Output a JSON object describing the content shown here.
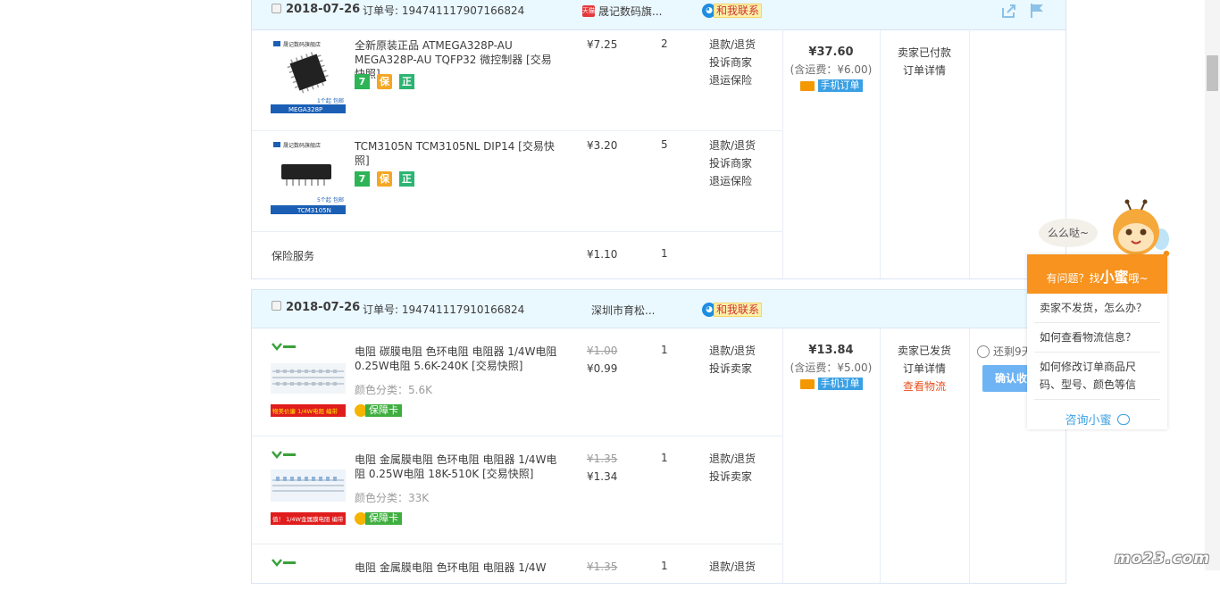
{
  "orders": [
    {
      "date": "2018-07-26",
      "order_no": "订单号: 194741117907166824",
      "shop_name": "晟记数码旗...",
      "contact": "和我联系",
      "items": [
        {
          "title": "全新原装正品 ATMEGA328P-AU MEGA328P-AU TQFP32 微控制器 [交易快照]",
          "price": "¥7.25",
          "qty": "2",
          "after_sale": [
            "退款/退货",
            "投诉商家",
            "退运保险"
          ],
          "badges": [
            "7",
            "保",
            "正"
          ],
          "thumb_caption": "MEGA328P",
          "thumb_store": "晟记数码旗舰店",
          "thumb_tag": "1个起",
          "thumb_free": "包邮"
        },
        {
          "title": "TCM3105N TCM3105NL DIP14 [交易快照]",
          "price": "¥3.20",
          "qty": "5",
          "after_sale": [
            "退款/退货",
            "投诉商家",
            "退运保险"
          ],
          "badges": [
            "7",
            "保",
            "正"
          ],
          "thumb_caption": "TCM3105N",
          "thumb_store": "晟记数码旗舰店",
          "thumb_tag": "5个起",
          "thumb_free": "包邮"
        },
        {
          "title": "保险服务",
          "price": "¥1.10",
          "qty": "1"
        }
      ],
      "total": "¥37.60",
      "shipping": "(含运费：¥6.00)",
      "mobile_label": "手机订单",
      "status": [
        "卖家已付款",
        "订单详情"
      ]
    },
    {
      "date": "2018-07-26",
      "order_no": "订单号: 194741117910166824",
      "shop_name": "深圳市育松...",
      "contact": "和我联系",
      "items": [
        {
          "title": "电阻 碳膜电阻 色环电阻 电阻器 1/4W电阻 0.25W电阻 5.6K-240K [交易快照]",
          "old_price": "¥1.00",
          "price": "¥0.99",
          "qty": "1",
          "after_sale": [
            "退款/退货",
            "投诉卖家"
          ],
          "spec": "颜色分类：5.6K",
          "guarantee": "保障卡",
          "thumb_banner": "物美价廉 1/4W电阻 编带"
        },
        {
          "title": "电阻 金属膜电阻 色环电阻 电阻器 1/4W电阻 0.25W电阻 18K-510K [交易快照]",
          "old_price": "¥1.35",
          "price": "¥1.34",
          "qty": "1",
          "after_sale": [
            "退款/退货",
            "投诉卖家"
          ],
          "spec": "颜色分类：33K",
          "guarantee": "保障卡",
          "thumb_banner": "值！ 1/4W金属膜电阻 编带"
        },
        {
          "title": "电阻 金属膜电阻 色环电阻 电阻器 1/4W",
          "old_price": "¥1.35",
          "qty": "1",
          "after_sale": [
            "退款/退货"
          ]
        }
      ],
      "total": "¥13.84",
      "shipping": "(含运费：¥5.00)",
      "mobile_label": "手机订单",
      "status": [
        "卖家已发货",
        "订单详情",
        "查看物流"
      ],
      "remaining": "还剩9天",
      "confirm": "确认收"
    }
  ],
  "helper": {
    "greeting": "么么哒~",
    "header_prefix": "有问题？找",
    "header_name": "小蜜",
    "header_suffix": "哦~",
    "questions": [
      "卖家不发货，怎么办？",
      "如何查看物流信息？",
      "如何修改订单商品尺码、型号、颜色等信"
    ],
    "ask": "咨询小蜜"
  },
  "watermark": "mo23.com",
  "colors": {
    "header_bg": "#eaf8ff",
    "accent_blue": "#3aa0e4",
    "orange": "#f7931e",
    "logistics": "#e8501f"
  }
}
